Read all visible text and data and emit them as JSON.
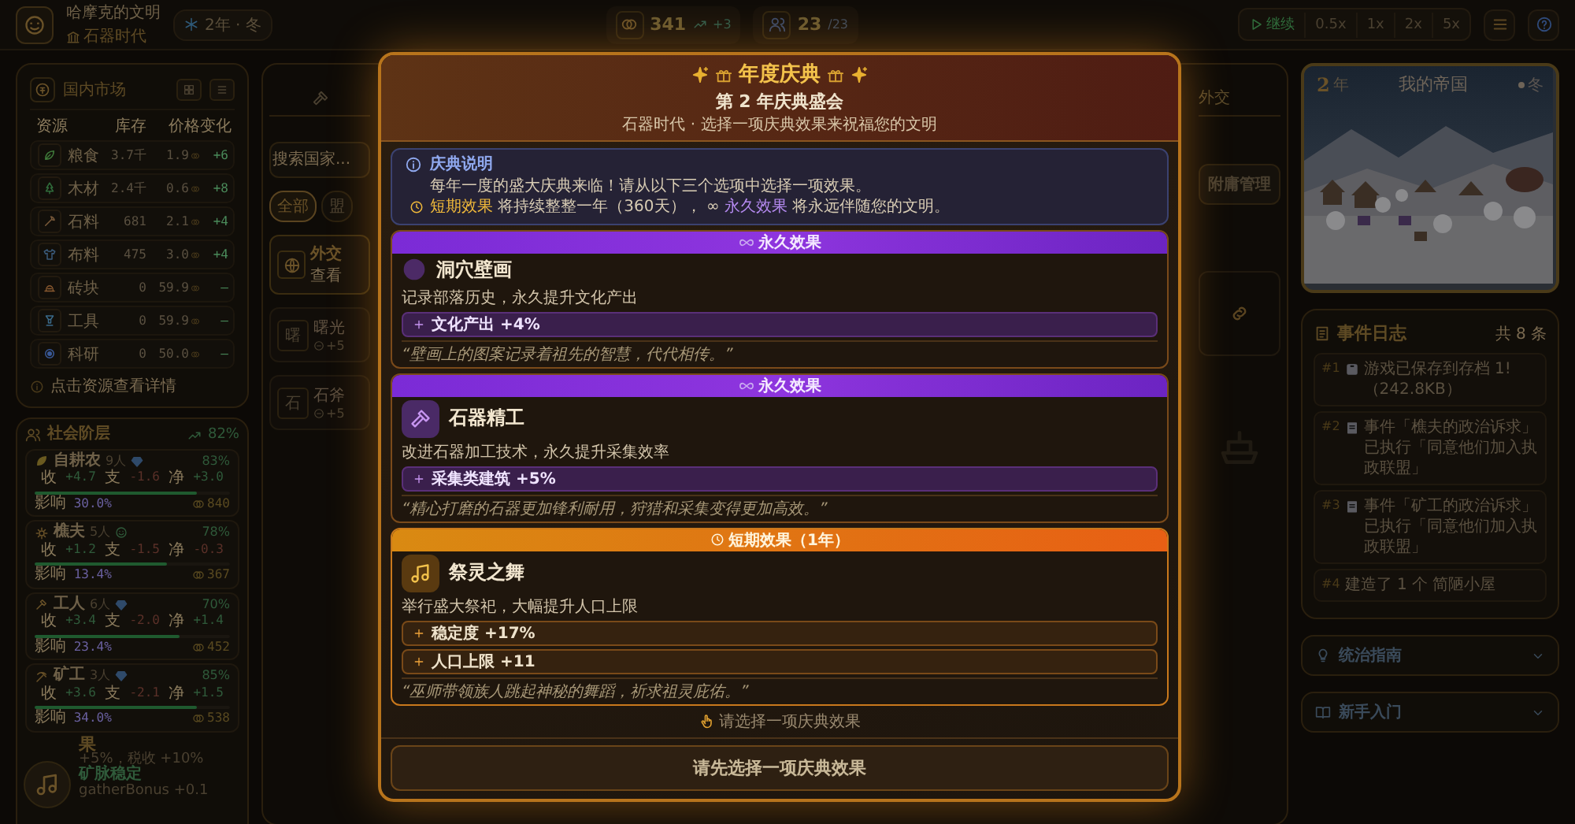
{
  "top_bar": {
    "civ_name": "哈摩克的文明",
    "era": "石器时代",
    "date": "2年 · 冬",
    "coins": "341",
    "coin_trend": "+3",
    "population": "23",
    "population_cap": "/23",
    "play_label": "继续",
    "speeds": [
      {
        "label": "0.5x",
        "selected": false
      },
      {
        "label": "1x",
        "selected": false
      },
      {
        "label": "2x",
        "selected": false
      },
      {
        "label": "5x",
        "selected": false
      }
    ]
  },
  "market": {
    "title": "国内市场",
    "columns": [
      "资源",
      "库存",
      "价格",
      "变化"
    ],
    "rows": [
      {
        "kind": "food",
        "name": "粮食",
        "stock": "3.7千",
        "price": "1.9",
        "change": "+6"
      },
      {
        "kind": "wood",
        "name": "木材",
        "stock": "2.4千",
        "price": "0.6",
        "change": "+8"
      },
      {
        "kind": "stone",
        "name": "石料",
        "stock": "681",
        "price": "2.1",
        "change": "+4"
      },
      {
        "kind": "cloth",
        "name": "布料",
        "stock": "475",
        "price": "3.0",
        "change": "+4"
      },
      {
        "kind": "brick",
        "name": "砖块",
        "stock": "0",
        "price": "59.9",
        "change": "—"
      },
      {
        "kind": "tools",
        "name": "工具",
        "stock": "0",
        "price": "59.9",
        "change": "—"
      },
      {
        "kind": "science",
        "name": "科研",
        "stock": "0",
        "price": "50.0",
        "change": "—"
      }
    ],
    "footer": "点击资源查看详情"
  },
  "strata": {
    "title": "社会阶层",
    "approval": "82%",
    "groups": [
      {
        "kind": "farmer",
        "name": "自耕农",
        "count": "9人",
        "approval": "83%",
        "income_label": "收",
        "income": "+4.7",
        "expense_label": "支",
        "expense": "-1.6",
        "net_label": "净",
        "net": "+3.0",
        "level": 0.83,
        "influence_label": "影响",
        "influence": "30.0%",
        "wealth": "840"
      },
      {
        "kind": "woodcutter",
        "name": "樵夫",
        "count": "5人",
        "approval": "78%",
        "income_label": "收",
        "income": "+1.2",
        "expense_label": "支",
        "expense": "-1.5",
        "net_label": "净",
        "net": "-0.3",
        "level": 0.68,
        "influence_label": "影响",
        "influence": "13.4%",
        "wealth": "367"
      },
      {
        "kind": "worker",
        "name": "工人",
        "count": "6人",
        "approval": "70%",
        "income_label": "收",
        "income": "+3.4",
        "expense_label": "支",
        "expense": "-2.0",
        "net_label": "净",
        "net": "+1.4",
        "level": 0.74,
        "influence_label": "影响",
        "influence": "23.4%",
        "wealth": "452"
      },
      {
        "kind": "miner",
        "name": "矿工",
        "count": "3人",
        "approval": "85%",
        "income_label": "收",
        "income": "+3.6",
        "expense_label": "支",
        "expense": "-2.1",
        "net_label": "净",
        "net": "+1.5",
        "level": 0.83,
        "influence_label": "影响",
        "influence": "34.0%",
        "wealth": "538"
      }
    ],
    "effects_title": "果",
    "effect_lines": [
      {
        "kind": "detail",
        "text": "+5%，税收 +10%"
      },
      {
        "kind": "heading",
        "text": "矿脉稳定"
      },
      {
        "kind": "detail",
        "text": "gatherBonus +0.1"
      }
    ]
  },
  "center_panel": {
    "tab_label": "外交",
    "search_placeholder": "搜索国家...",
    "filters": [
      {
        "label": "全部",
        "selected": true
      },
      {
        "label": "盟",
        "selected": false
      }
    ],
    "feature_card": {
      "title": "外交",
      "subtitle": "查看"
    },
    "nations": [
      {
        "avatar": "曙",
        "name": "曙光",
        "bonus": "+5"
      },
      {
        "avatar": "石",
        "name": "石斧",
        "bonus": "+5"
      }
    ],
    "vassal_button": "附庸管理"
  },
  "empire_view": {
    "year": "2",
    "year_unit": "年",
    "title": "我的帝国",
    "season": "冬"
  },
  "event_log": {
    "title": "事件日志",
    "count": "共 8 条",
    "entries": [
      {
        "index": "#1",
        "kind": "save",
        "text": "游戏已保存到存档 1!（242.8KB）"
      },
      {
        "index": "#2",
        "kind": "event",
        "text": "事件「樵夫的政治诉求」已执行「同意他们加入执政联盟」"
      },
      {
        "index": "#3",
        "kind": "event",
        "text": "事件「矿工的政治诉求」已执行「同意他们加入执政联盟」"
      },
      {
        "index": "#4",
        "kind": "plain",
        "text": "建造了 1 个 简陋小屋"
      }
    ]
  },
  "guides": [
    {
      "kind": "bulb",
      "label": "统治指南",
      "expanded": false
    },
    {
      "kind": "book",
      "label": "新手入门",
      "expanded": false
    }
  ],
  "celebration": {
    "title": "年度庆典",
    "subtitle": "第 2 年庆典盛会",
    "era_line": "石器时代 · 选择一项庆典效果来祝福您的文明",
    "info": {
      "title": "庆典说明",
      "lines": [
        "每年一度的盛大庆典来临！请从以下三个选项中选择一项效果。",
        "**短期效果** 将持续整整一年（360天）， ∞ **永久效果** 将永远伴随您的文明。"
      ]
    },
    "options": [
      {
        "kind": "permanent",
        "header": "永久效果",
        "name": "洞穴壁画",
        "description": "记录部落历史，永久提升文化产出",
        "effects": [
          "文化产出 +4%"
        ],
        "quote": "“壁画上的图案记录着祖先的智慧，代代相传。”",
        "selected": false
      },
      {
        "kind": "permanent",
        "header": "永久效果",
        "name": "石器精工",
        "description": "改进石器加工技术，永久提升采集效率",
        "effects": [
          "采集类建筑 +5%"
        ],
        "quote": "“精心打磨的石器更加锋利耐用，狩猎和采集变得更加高效。”",
        "selected": false
      },
      {
        "kind": "temporary",
        "header": "短期效果（1年）",
        "name": "祭灵之舞",
        "description": "举行盛大祭祀，大幅提升人口上限",
        "effects": [
          "稳定度 +17%",
          "人口上限 +11"
        ],
        "quote": "“巫师带领族人跳起神秘的舞蹈，祈求祖灵庇佑。”",
        "selected": false
      }
    ],
    "hint": "请选择一项庆典效果",
    "confirm": {
      "label": "请先选择一项庆典效果",
      "disabled": true
    }
  }
}
